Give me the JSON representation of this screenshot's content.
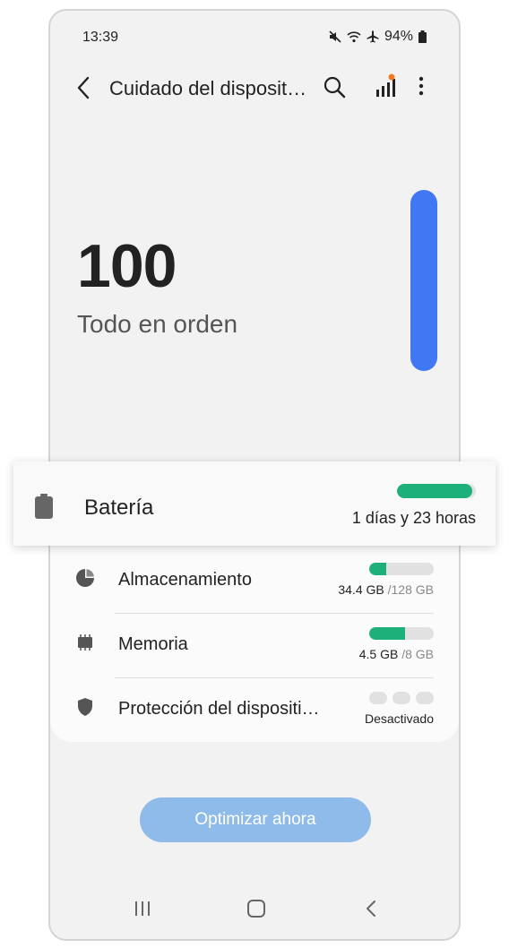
{
  "status_bar": {
    "time": "13:39",
    "battery": "94%",
    "icons": [
      "mute-icon",
      "wifi-icon",
      "airplane-icon",
      "battery-icon"
    ]
  },
  "header": {
    "title": "Cuidado del disposit…",
    "icons": [
      "back-icon",
      "search-icon",
      "signal-bars-icon",
      "more-vert-icon"
    ]
  },
  "score": {
    "value": "100",
    "status": "Todo en orden",
    "level": 1.0,
    "bar_color": "#3f78f2"
  },
  "battery": {
    "label": "Batería",
    "value": "1 días y 23 horas",
    "level": 0.95,
    "icon": "battery-icon"
  },
  "items": [
    {
      "label": "Almacenamiento",
      "used": "34.4 GB",
      "total": "/128 GB",
      "level": 0.27,
      "icon": "pie-chart-icon"
    },
    {
      "label": "Memoria",
      "used": "4.5 GB",
      "total": "/8 GB",
      "level": 0.56,
      "icon": "memory-chip-icon"
    },
    {
      "label": "Protección del dispositi…",
      "status": "Desactivado",
      "icon": "shield-icon"
    }
  ],
  "optimize_button": {
    "label": "Optimizar ahora"
  },
  "nav": {
    "icons": [
      "recent-apps-icon",
      "home-icon",
      "nav-back-icon"
    ]
  },
  "colors": {
    "accent_green": "#1eb07a",
    "score_blue": "#3f78f2",
    "button_blue": "#8fbbea"
  }
}
